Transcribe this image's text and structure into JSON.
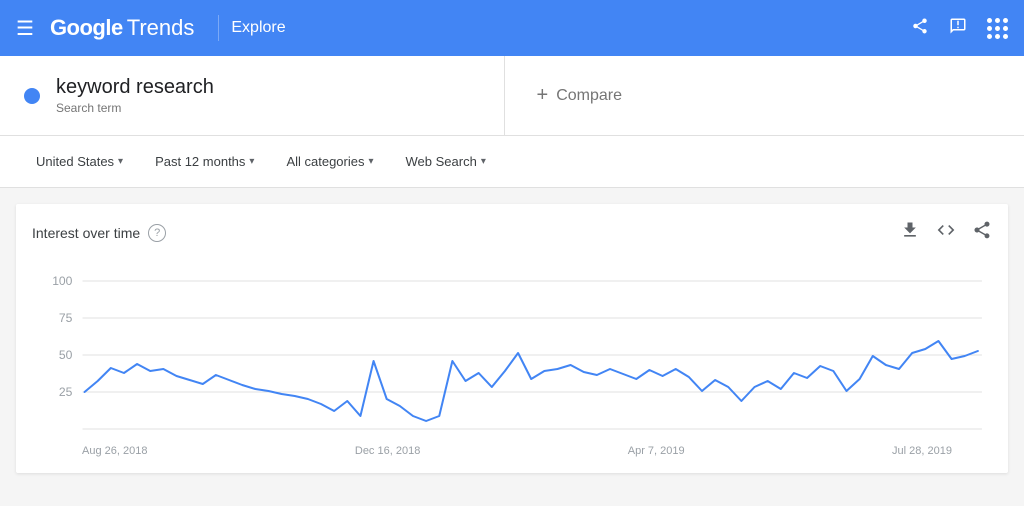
{
  "header": {
    "logo_google": "Google",
    "logo_trends": "Trends",
    "explore_label": "Explore",
    "hamburger": "☰",
    "share_icon": "⤴",
    "feedback_icon": "✉"
  },
  "search_bar": {
    "search_term": "keyword research",
    "search_term_label": "Search term",
    "compare_label": "Compare",
    "compare_plus": "+"
  },
  "filters": {
    "region": "United States",
    "time_range": "Past 12 months",
    "categories": "All categories",
    "search_type": "Web Search"
  },
  "chart": {
    "title": "Interest over time",
    "help": "?",
    "download_icon": "⬇",
    "embed_icon": "<>",
    "share_icon": "⤴",
    "x_labels": [
      "Aug 26, 2018",
      "Dec 16, 2018",
      "Apr 7, 2019",
      "Jul 28, 2019"
    ],
    "y_labels": [
      "100",
      "75",
      "50",
      "25"
    ],
    "line_color": "#4285f4",
    "grid_color": "#e0e0e0"
  }
}
